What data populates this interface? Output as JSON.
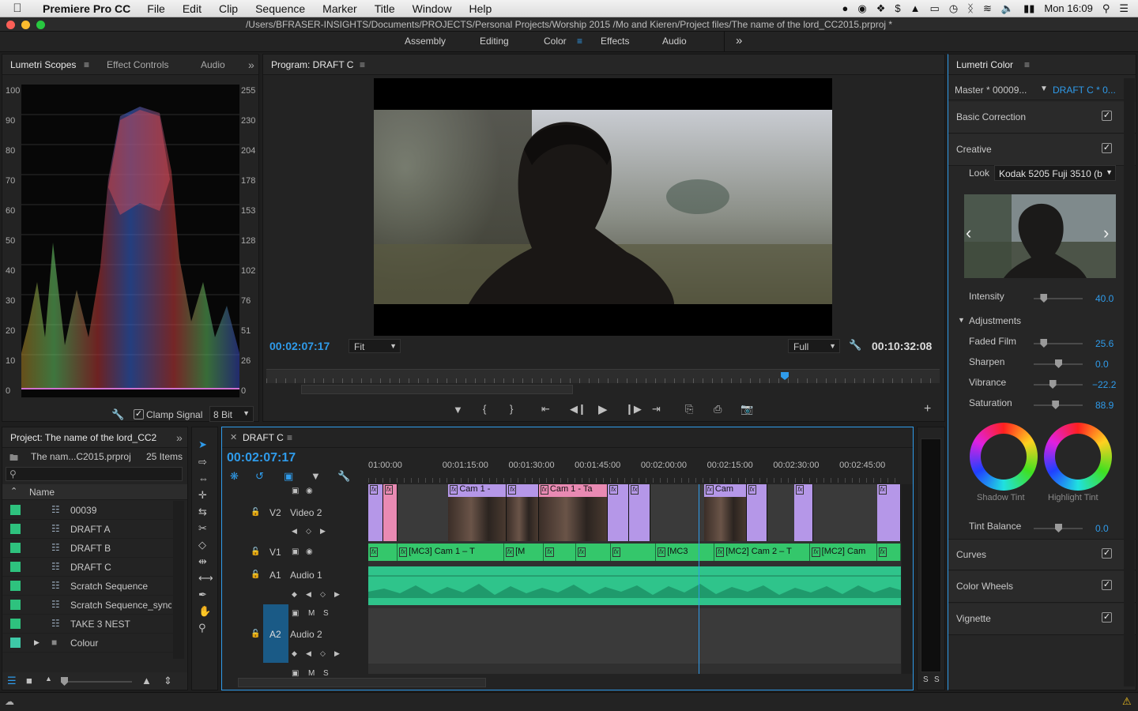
{
  "menubar": {
    "app_name": "Premiere Pro CC",
    "items": [
      "File",
      "Edit",
      "Clip",
      "Sequence",
      "Marker",
      "Title",
      "Window",
      "Help"
    ],
    "clock": "Mon 16:09"
  },
  "window": {
    "path": "/Users/BFRASER-INSIGHTS/Documents/PROJECTS/Personal Projects/Worship 2015 /Mo and Kieren/Project files/The name of the lord_CC2015.prproj *"
  },
  "workspaces": {
    "items": [
      "Assembly",
      "Editing",
      "Color",
      "Effects",
      "Audio"
    ],
    "active": "Color",
    "overflow": "»"
  },
  "scopes": {
    "tabs": [
      "Lumetri Scopes",
      "Effect Controls",
      "Audio"
    ],
    "left_scale": [
      "100",
      "90",
      "80",
      "70",
      "60",
      "50",
      "40",
      "30",
      "20",
      "10",
      "0"
    ],
    "right_scale": [
      "255",
      "230",
      "204",
      "178",
      "153",
      "128",
      "102",
      "76",
      "51",
      "26",
      "0"
    ],
    "clamp_label": "Clamp Signal",
    "bit_depth": "8 Bit"
  },
  "program": {
    "title": "Program: DRAFT C",
    "timecode": "00:02:07:17",
    "duration": "00:10:32:08",
    "fit": "Fit",
    "quality": "Full",
    "playhead_fraction": 0.77
  },
  "lumetri": {
    "title": "Lumetri Color",
    "master": "Master * 00009...",
    "sequence": "DRAFT C * 0...",
    "basic_correction": "Basic Correction",
    "creative": "Creative",
    "look_label": "Look",
    "look_value": "Kodak 5205 Fuji 3510 (b",
    "intensity": {
      "label": "Intensity",
      "value": "40.0",
      "fraction": 0.2
    },
    "adjustments": "Adjustments",
    "faded_film": {
      "label": "Faded Film",
      "value": "25.6",
      "fraction": 0.2
    },
    "sharpen": {
      "label": "Sharpen",
      "value": "0.0",
      "fraction": 0.5
    },
    "vibrance": {
      "label": "Vibrance",
      "value": "−22.2",
      "fraction": 0.38
    },
    "saturation": {
      "label": "Saturation",
      "value": "88.9",
      "fraction": 0.44
    },
    "shadow_tint": "Shadow Tint",
    "highlight_tint": "Highlight Tint",
    "tint_balance": {
      "label": "Tint Balance",
      "value": "0.0",
      "fraction": 0.5
    },
    "curves": "Curves",
    "color_wheels": "Color Wheels",
    "vignette": "Vignette"
  },
  "project": {
    "title": "Project: The name of the lord_CC2",
    "file": "The nam...C2015.prproj",
    "count": "25 Items",
    "column": "Name",
    "items": [
      {
        "name": "00039",
        "color": "#2ec27e"
      },
      {
        "name": "DRAFT A",
        "color": "#2ec27e"
      },
      {
        "name": "DRAFT B",
        "color": "#2ec27e"
      },
      {
        "name": "DRAFT C",
        "color": "#2ec27e"
      },
      {
        "name": "Scratch Sequence",
        "color": "#2ec27e"
      },
      {
        "name": "Scratch Sequence_synce",
        "color": "#2ec27e"
      },
      {
        "name": "TAKE 3 NEST",
        "color": "#2ec27e"
      },
      {
        "name": "Colour",
        "color": "#3ec9a7"
      }
    ]
  },
  "timeline": {
    "title": "DRAFT C",
    "timecode": "00:02:07:17",
    "ruler": [
      "01:00:00",
      "00:01:15:00",
      "00:01:30:00",
      "00:01:45:00",
      "00:02:00:00",
      "00:02:15:00",
      "00:02:30:00",
      "00:02:45:00"
    ],
    "tracks": {
      "v2": "V2",
      "v2_name": "Video 2",
      "v1": "V1",
      "a1": "A1",
      "a1_name": "Audio 1",
      "a2": "A2",
      "a2_name": "Audio 2"
    },
    "v2_clips": [
      {
        "label": "",
        "start": 0.0,
        "end": 0.028,
        "color": "#b597e8"
      },
      {
        "label": "",
        "start": 0.028,
        "end": 0.055,
        "color": "#e98ab3"
      },
      {
        "label": "Cam 1 -",
        "start": 0.15,
        "end": 0.26,
        "color": "#b597e8"
      },
      {
        "label": "",
        "start": 0.26,
        "end": 0.32,
        "color": "#b597e8"
      },
      {
        "label": "Cam 1 - Ta",
        "start": 0.32,
        "end": 0.45,
        "color": "#e98ab3"
      },
      {
        "label": "",
        "start": 0.45,
        "end": 0.49,
        "color": "#b597e8"
      },
      {
        "label": "",
        "start": 0.49,
        "end": 0.53,
        "color": "#b597e8"
      },
      {
        "label": "Cam",
        "start": 0.63,
        "end": 0.71,
        "color": "#b597e8"
      },
      {
        "label": "",
        "start": 0.71,
        "end": 0.75,
        "color": "#b597e8"
      },
      {
        "label": "",
        "start": 0.8,
        "end": 0.835,
        "color": "#b597e8"
      },
      {
        "label": "",
        "start": 0.955,
        "end": 1.0,
        "color": "#b597e8"
      }
    ],
    "v1_clips": [
      {
        "label": "",
        "start": 0.0,
        "end": 0.055
      },
      {
        "label": "[MC3] Cam 1 – T",
        "start": 0.055,
        "end": 0.255
      },
      {
        "label": "[M",
        "start": 0.255,
        "end": 0.33
      },
      {
        "label": "",
        "start": 0.33,
        "end": 0.39
      },
      {
        "label": "",
        "start": 0.39,
        "end": 0.455
      },
      {
        "label": "",
        "start": 0.455,
        "end": 0.54
      },
      {
        "label": "[MC3",
        "start": 0.54,
        "end": 0.65
      },
      {
        "label": "[MC2] Cam 2 – T",
        "start": 0.65,
        "end": 0.83
      },
      {
        "label": "[MC2] Cam",
        "start": 0.83,
        "end": 0.955
      },
      {
        "label": "",
        "start": 0.955,
        "end": 1.0
      }
    ],
    "playhead_fraction": 0.62
  }
}
